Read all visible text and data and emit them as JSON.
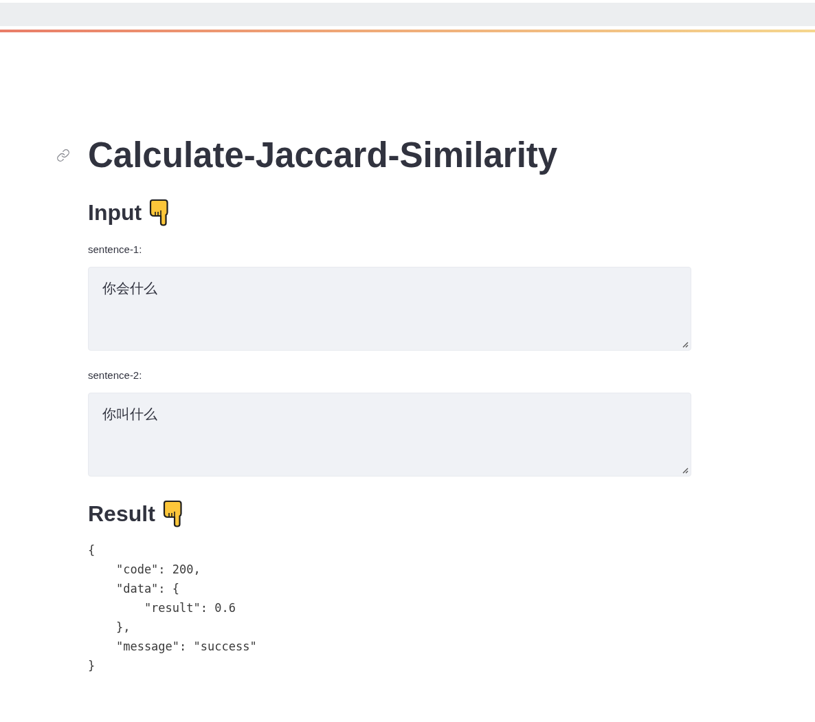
{
  "title": "Calculate-Jaccard-Similarity",
  "input_section": {
    "heading": "Input",
    "fields": [
      {
        "label": "sentence-1:",
        "value": "你会什么"
      },
      {
        "label": "sentence-2:",
        "value": "你叫什么"
      }
    ]
  },
  "result_section": {
    "heading": "Result",
    "output": "{\n    \"code\": 200,\n    \"data\": {\n        \"result\": 0.6\n    },\n    \"message\": \"success\"\n}"
  }
}
